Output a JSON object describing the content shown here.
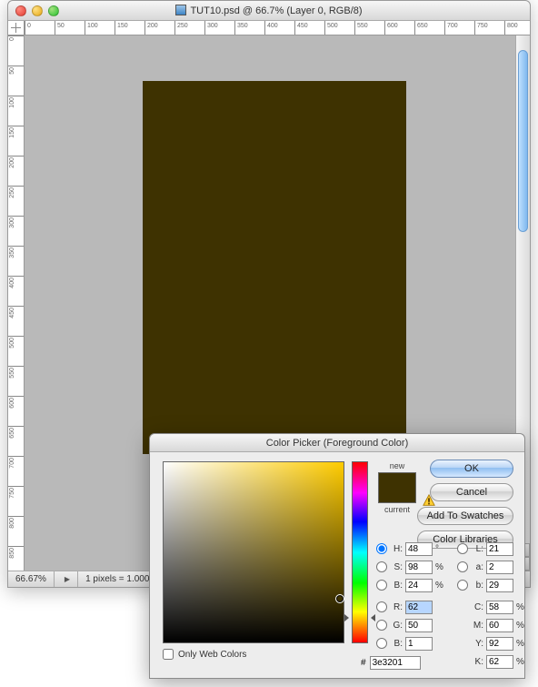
{
  "window": {
    "title": "TUT10.psd @ 66.7% (Layer 0, RGB/8)",
    "zoom": "66.67%",
    "status_info": "1 pixels = 1.000",
    "ruler_marks": [
      "0",
      "50",
      "100",
      "150",
      "200",
      "250",
      "300",
      "350",
      "400",
      "450",
      "500",
      "550",
      "600",
      "650",
      "700",
      "750",
      "800"
    ],
    "ruler_marks_v": [
      "0",
      "50",
      "100"
    ]
  },
  "canvas": {
    "fill": "#3e3201"
  },
  "picker": {
    "title": "Color Picker (Foreground Color)",
    "new_label": "new",
    "current_label": "current",
    "new_color": "#3e3201",
    "current_color": "#3e3201",
    "hue_deg": 48,
    "buttons": {
      "ok": "OK",
      "cancel": "Cancel",
      "add": "Add To Swatches",
      "libs": "Color Libraries"
    },
    "only_web": "Only Web Colors",
    "hsb": {
      "H": "48",
      "Hu": "°",
      "S": "98",
      "Su": "%",
      "B": "24",
      "Bu": "%"
    },
    "rgb": {
      "R": "62",
      "G": "50",
      "B": "1"
    },
    "lab": {
      "L": "21",
      "a": "2",
      "b": "29"
    },
    "cmyk": {
      "C": "58",
      "M": "60",
      "Y": "92",
      "K": "62",
      "u": "%"
    },
    "hex_label": "#",
    "hex": "3e3201"
  }
}
